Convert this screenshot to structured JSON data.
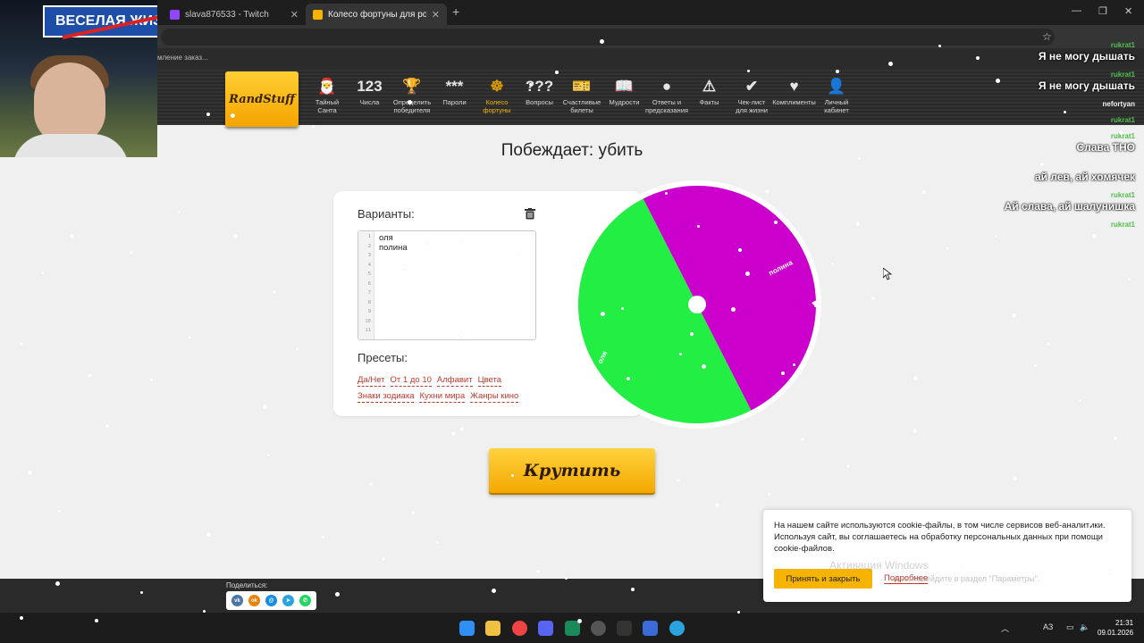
{
  "browser": {
    "tabs": [
      {
        "title": "slava876533 - Twitch",
        "favicon_color": "#9146ff"
      },
      {
        "title": "Колесо фортуны для розыгрыш",
        "favicon_color": "#f5b400"
      }
    ],
    "new_tab": "+",
    "bookmark_text": "мление заказ..."
  },
  "webcam": {
    "sign_text": "ВЕСЕЛАЯ ЖИЗ",
    "speed_sign": "50"
  },
  "site": {
    "logo": "RandStuff",
    "nav": [
      {
        "icon": "santa-icon",
        "glyph": "🎅",
        "label": "Тайный Санта"
      },
      {
        "icon": "numbers-icon",
        "glyph": "123",
        "label": "Числа"
      },
      {
        "icon": "trophy-icon",
        "glyph": "🏆",
        "label": "Определить победителя"
      },
      {
        "icon": "password-icon",
        "glyph": "***",
        "label": "Пароли"
      },
      {
        "icon": "wheel-icon",
        "glyph": "☸",
        "label": "Колесо фортуны",
        "active": true
      },
      {
        "icon": "questions-icon",
        "glyph": "???",
        "label": "Вопросы"
      },
      {
        "icon": "ticket-icon",
        "glyph": "🎫",
        "label": "Счастливые билеты"
      },
      {
        "icon": "book-icon",
        "glyph": "📖",
        "label": "Мудрости"
      },
      {
        "icon": "ball-icon",
        "glyph": "●",
        "label": "Ответы и предсказания"
      },
      {
        "icon": "warning-icon",
        "glyph": "⚠",
        "label": "Факты"
      },
      {
        "icon": "checklist-icon",
        "glyph": "✔",
        "label": "Чек-лист для жизни"
      },
      {
        "icon": "heart-icon",
        "glyph": "♥",
        "label": "Комплименты"
      },
      {
        "icon": "user-icon",
        "glyph": "👤",
        "label": "Личный кабинет"
      }
    ]
  },
  "main": {
    "winner_text": "Побеждает: убить",
    "variants_title": "Варианты:",
    "variants_lines": [
      "оля",
      "полина"
    ],
    "line_numbers": [
      "1",
      "2",
      "3",
      "4",
      "5",
      "6",
      "7",
      "8",
      "9",
      "10",
      "11"
    ],
    "presets_title": "Пресеты:",
    "presets": [
      "Да/Нет",
      "От 1 до 10",
      "Алфавит",
      "Цвета",
      "Знаки зодиака",
      "Кухни мира",
      "Жанры кино"
    ],
    "spin_label": "Крутить"
  },
  "wheel": {
    "segments": [
      {
        "label": "полина",
        "color": "#cc00cc"
      },
      {
        "label": "оля",
        "color": "#22ee44"
      }
    ]
  },
  "chat": [
    {
      "user": "rukrat1",
      "user_color": "#4fbf4f",
      "text": "Я не могу дышать"
    },
    {
      "user": "rukrat1",
      "user_color": "#4fbf4f",
      "text": "Я не могу дышать"
    },
    {
      "user": "nefortyan",
      "user_color": "#f0f0f0",
      "text": ""
    },
    {
      "user": "rukrat1",
      "user_color": "#4fbf4f",
      "text": ""
    },
    {
      "user": "rukrat1",
      "user_color": "#4fbf4f",
      "text": "Слава ТНО"
    },
    {
      "user": "nefortyan",
      "user_color": "#f0f0f0",
      "text": "ай лев, ай хомячек"
    },
    {
      "user": "rukrat1",
      "user_color": "#4fbf4f",
      "text": "Ай слава, ай шалунишка"
    },
    {
      "user": "rukrat1",
      "user_color": "#4fbf4f",
      "text": ""
    }
  ],
  "cookie": {
    "text": "На нашем сайте используются cookie-файлы, в том числе сервисов веб-аналитики. Используя сайт, вы соглашаетесь на обработку персональных данных при помощи cookie-файлов.",
    "accept": "Принять и закрыть",
    "more": "Подробнее"
  },
  "windows_activation": {
    "title": "Активация Windows",
    "subtitle": "ows, перейдите в раздел \"Параметры\"."
  },
  "footer": {
    "share_label": "Поделиться:",
    "socials": [
      {
        "name": "vk-icon",
        "color": "#4a76a8",
        "glyph": "vk"
      },
      {
        "name": "ok-icon",
        "color": "#ee8208",
        "glyph": "ok"
      },
      {
        "name": "mail-icon",
        "color": "#168de2",
        "glyph": "@"
      },
      {
        "name": "telegram-icon",
        "color": "#2aa3df",
        "glyph": "➤"
      },
      {
        "name": "whatsapp-icon",
        "color": "#25d366",
        "glyph": "✆"
      }
    ]
  },
  "taskbar": {
    "lang": "АЗ",
    "time": "21:31",
    "date": "09.01.2026"
  }
}
